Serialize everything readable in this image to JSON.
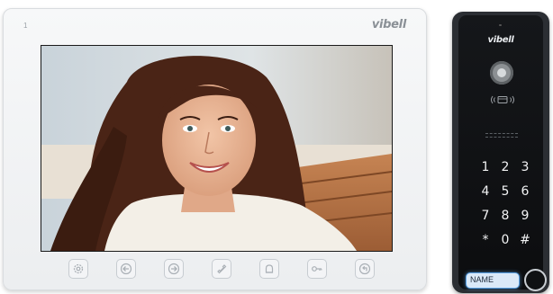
{
  "monitor": {
    "corner_mark": "1",
    "brand": "vibell",
    "buttons": [
      {
        "icon": "gear-icon"
      },
      {
        "icon": "arrow-left-icon"
      },
      {
        "icon": "arrow-right-icon"
      },
      {
        "icon": "phone-handset-icon"
      },
      {
        "icon": "bell-icon"
      },
      {
        "icon": "key-icon"
      },
      {
        "icon": "return-icon"
      }
    ]
  },
  "door_station": {
    "brand": "vibell",
    "keypad": [
      "1",
      "2",
      "3",
      "4",
      "5",
      "6",
      "7",
      "8",
      "9",
      "*",
      "0",
      "#"
    ],
    "name_label": "NAME"
  },
  "colors": {
    "monitor_body": "#eceef0",
    "station_body": "#0c0d0f",
    "name_plate_glow": "#5aa2e6"
  }
}
